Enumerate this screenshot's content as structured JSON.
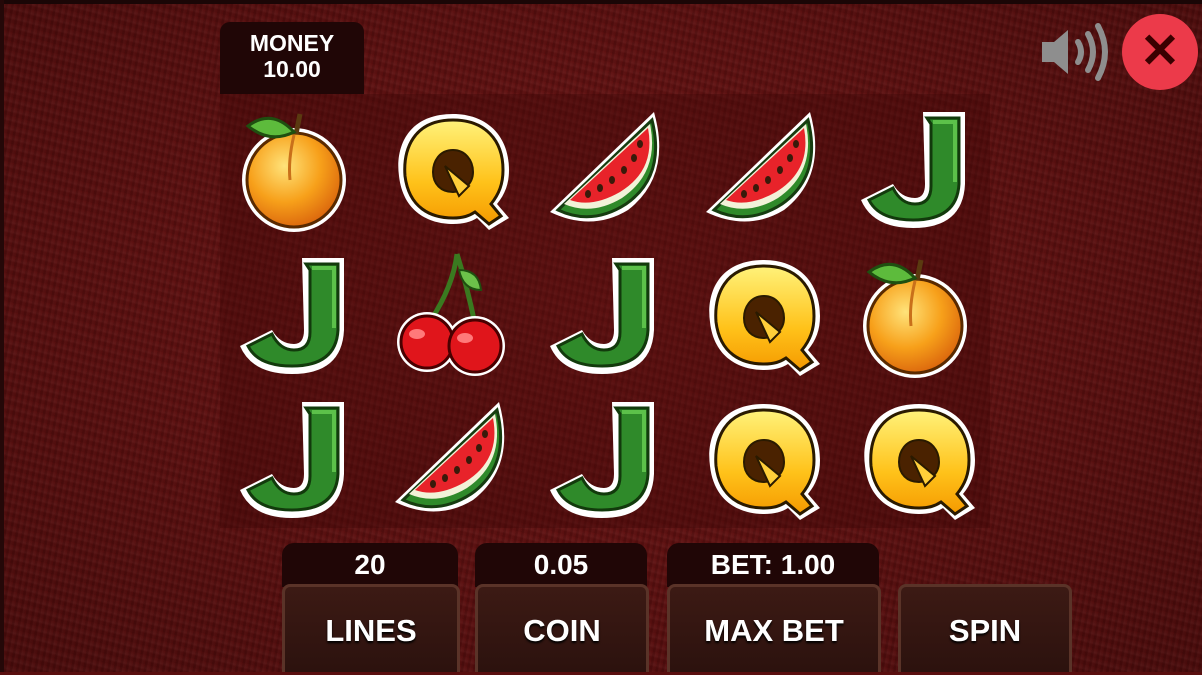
{
  "money": {
    "label": "MONEY",
    "value": "10.00"
  },
  "reels": [
    [
      "peach",
      "q",
      "watermelon",
      "watermelon",
      "j"
    ],
    [
      "j",
      "cherry",
      "j",
      "q",
      "peach"
    ],
    [
      "j",
      "watermelon",
      "j",
      "q",
      "q"
    ]
  ],
  "controls": {
    "lines_value": "20",
    "coin_value": "0.05",
    "bet_value": "BET: 1.00",
    "lines_label": "LINES",
    "coin_label": "COIN",
    "max_bet_label": "MAX BET",
    "spin_label": "SPIN"
  },
  "icons": {
    "sound": "speaker-icon",
    "close": "close-icon",
    "close_glyph": "✕"
  },
  "colors": {
    "close_button": "#ec3a4a",
    "background": "#5a0f0f",
    "panel": "#200606"
  }
}
